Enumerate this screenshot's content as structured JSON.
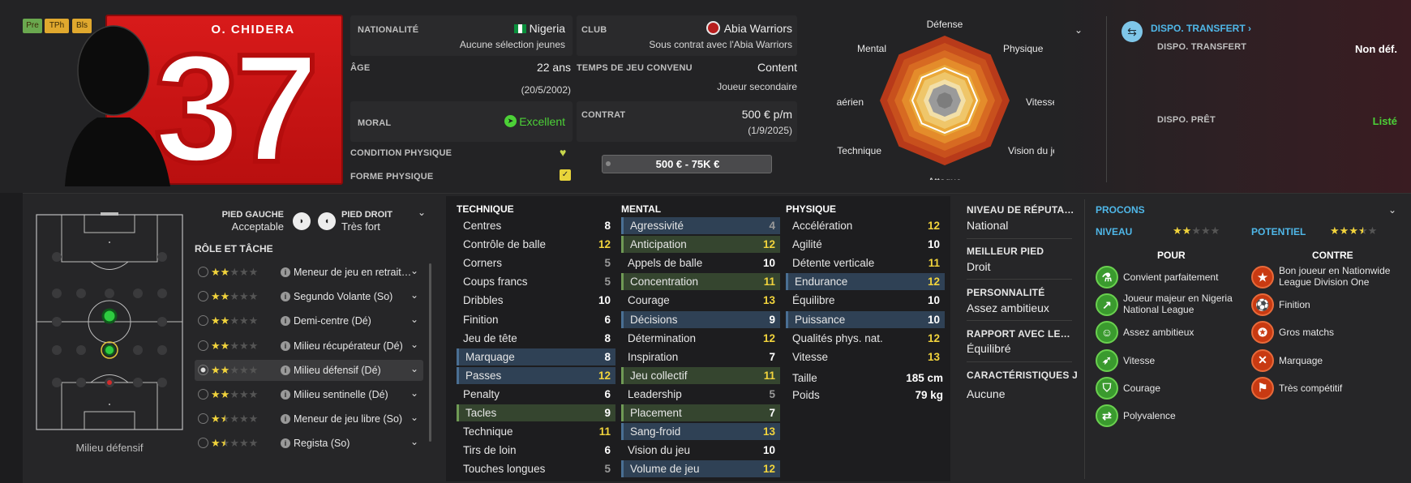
{
  "player": {
    "name": "O. CHIDERA",
    "number": "37",
    "badges": [
      "Pre",
      "TPh",
      "Bls"
    ]
  },
  "info": {
    "nationality_label": "NATIONALITÉ",
    "nationality_value": "Nigeria",
    "nationality_sub": "Aucune sélection jeunes",
    "club_label": "CLUB",
    "club_value": "Abia Warriors",
    "club_sub": "Sous contrat avec l'Abia Warriors",
    "age_label": "ÂGE",
    "age_value": "22 ans",
    "age_sub": "(20/5/2002)",
    "playing_time_label": "TEMPS DE JEU CONVENU",
    "playing_time_value": "Content",
    "playing_time_sub": "Joueur secondaire",
    "morale_label": "MORAL",
    "morale_value": "Excellent",
    "contract_label": "CONTRAT",
    "contract_value": "500 € p/m",
    "contract_sub": "(1/9/2025)",
    "condition_label": "CONDITION PHYSIQUE",
    "form_label": "FORME PHYSIQUE",
    "value_range": "500 € - 75K €"
  },
  "radar": {
    "labels": [
      "Défense",
      "Physique",
      "Vitesse",
      "Vision du jeu",
      "Attaque",
      "Technique",
      "Jeu aérien",
      "Mental"
    ]
  },
  "transfer": {
    "title": "DISPO. TRANSFERT ›",
    "transfer_label": "DISPO. TRANSFERT",
    "transfer_value": "Non déf.",
    "loan_label": "DISPO. PRÊT",
    "loan_value": "Listé"
  },
  "feet": {
    "left_label": "PIED GAUCHE",
    "left_value": "Acceptable",
    "right_label": "PIED DROIT",
    "right_value": "Très fort"
  },
  "roles": {
    "title": "RÔLE ET TÂCHE",
    "pitch_caption": "Milieu défensif",
    "items": [
      {
        "label": "Meneur de jeu en retrait…",
        "stars": 2
      },
      {
        "label": "Segundo Volante (So)",
        "stars": 2
      },
      {
        "label": "Demi-centre (Dé)",
        "stars": 2
      },
      {
        "label": "Milieu récupérateur (Dé)",
        "stars": 2
      },
      {
        "label": "Milieu défensif (Dé)",
        "stars": 2
      },
      {
        "label": "Milieu sentinelle (Dé)",
        "stars": 2
      },
      {
        "label": "Meneur de jeu libre (So)",
        "stars": 1.5
      },
      {
        "label": "Regista (So)",
        "stars": 1.5
      }
    ]
  },
  "attributes": {
    "technique_title": "TECHNIQUE",
    "mental_title": "MENTAL",
    "physique_title": "PHYSIQUE",
    "technique": [
      {
        "name": "Centres",
        "value": "8",
        "hl": ""
      },
      {
        "name": "Contrôle de balle",
        "value": "12",
        "hl": ""
      },
      {
        "name": "Corners",
        "value": "5",
        "hl": ""
      },
      {
        "name": "Coups francs",
        "value": "5",
        "hl": ""
      },
      {
        "name": "Dribbles",
        "value": "10",
        "hl": ""
      },
      {
        "name": "Finition",
        "value": "6",
        "hl": ""
      },
      {
        "name": "Jeu de tête",
        "value": "8",
        "hl": ""
      },
      {
        "name": "Marquage",
        "value": "8",
        "hl": "blue"
      },
      {
        "name": "Passes",
        "value": "12",
        "hl": "blue"
      },
      {
        "name": "Penalty",
        "value": "6",
        "hl": ""
      },
      {
        "name": "Tacles",
        "value": "9",
        "hl": "green"
      },
      {
        "name": "Technique",
        "value": "11",
        "hl": ""
      },
      {
        "name": "Tirs de loin",
        "value": "6",
        "hl": ""
      },
      {
        "name": "Touches longues",
        "value": "5",
        "hl": ""
      }
    ],
    "mental": [
      {
        "name": "Agressivité",
        "value": "4",
        "hl": "blue"
      },
      {
        "name": "Anticipation",
        "value": "12",
        "hl": "green"
      },
      {
        "name": "Appels de balle",
        "value": "10",
        "hl": ""
      },
      {
        "name": "Concentration",
        "value": "11",
        "hl": "green"
      },
      {
        "name": "Courage",
        "value": "13",
        "hl": ""
      },
      {
        "name": "Décisions",
        "value": "9",
        "hl": "blue"
      },
      {
        "name": "Détermination",
        "value": "12",
        "hl": ""
      },
      {
        "name": "Inspiration",
        "value": "7",
        "hl": ""
      },
      {
        "name": "Jeu collectif",
        "value": "11",
        "hl": "green"
      },
      {
        "name": "Leadership",
        "value": "5",
        "hl": ""
      },
      {
        "name": "Placement",
        "value": "7",
        "hl": "green"
      },
      {
        "name": "Sang-froid",
        "value": "13",
        "hl": "blue"
      },
      {
        "name": "Vision du jeu",
        "value": "10",
        "hl": ""
      },
      {
        "name": "Volume de jeu",
        "value": "12",
        "hl": "blue"
      }
    ],
    "physique": [
      {
        "name": "Accélération",
        "value": "12",
        "hl": ""
      },
      {
        "name": "Agilité",
        "value": "10",
        "hl": ""
      },
      {
        "name": "Détente verticale",
        "value": "11",
        "hl": ""
      },
      {
        "name": "Endurance",
        "value": "12",
        "hl": "blue"
      },
      {
        "name": "Équilibre",
        "value": "10",
        "hl": ""
      },
      {
        "name": "Puissance",
        "value": "10",
        "hl": "blue"
      },
      {
        "name": "Qualités phys. nat.",
        "value": "12",
        "hl": ""
      },
      {
        "name": "Vitesse",
        "value": "13",
        "hl": ""
      }
    ],
    "height_label": "Taille",
    "height_value": "185 cm",
    "weight_label": "Poids",
    "weight_value": "79 kg"
  },
  "details": {
    "reputation_label": "NIVEAU DE RÉPUTA…",
    "reputation_value": "National",
    "best_foot_label": "MEILLEUR PIED",
    "best_foot_value": "Droit",
    "personality_label": "PERSONNALITÉ",
    "personality_value": "Assez ambitieux",
    "media_label": "RAPPORT AVEC LE…",
    "media_value": "Équilibré",
    "traits_label": "CARACTÉRISTIQUES J",
    "traits_value": "Aucune"
  },
  "procons": {
    "title": "PROCONS",
    "level_label": "NIVEAU",
    "level_stars": 2,
    "potential_label": "POTENTIEL",
    "potential_stars": 3.5,
    "pros_title": "POUR",
    "cons_title": "CONTRE",
    "pros": [
      {
        "text": "Convient parfaitement",
        "icon": "flask-icon"
      },
      {
        "text": "Joueur majeur en Nigeria National League",
        "icon": "trend-icon"
      },
      {
        "text": "Assez ambitieux",
        "icon": "head-icon"
      },
      {
        "text": "Vitesse",
        "icon": "speed-icon"
      },
      {
        "text": "Courage",
        "icon": "shield-icon"
      },
      {
        "text": "Polyvalence",
        "icon": "versatility-icon"
      }
    ],
    "cons": [
      {
        "text": "Bon joueur en Nationwide League Division One",
        "icon": "star-icon"
      },
      {
        "text": "Finition",
        "icon": "finishing-icon"
      },
      {
        "text": "Gros matchs",
        "icon": "big-match-icon"
      },
      {
        "text": "Marquage",
        "icon": "marking-icon"
      },
      {
        "text": "Très compétitif",
        "icon": "competitive-icon"
      }
    ]
  },
  "colors": {
    "accent_blue": "#4fb7e8",
    "value_yellow": "#f1d33c",
    "green_good": "#4cd137",
    "red_number_bg": "#d11a1a",
    "highlight_blue": "#2f4155",
    "highlight_green": "#35452f"
  }
}
